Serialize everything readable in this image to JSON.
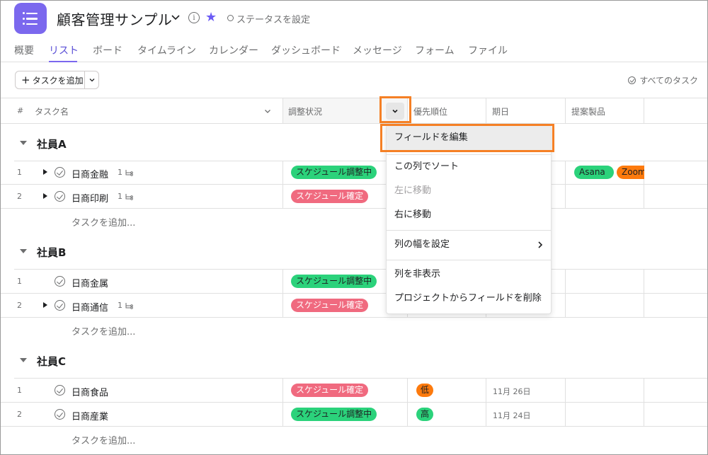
{
  "header": {
    "project_title": "顧客管理サンプル",
    "status_label": "ステータスを設定",
    "colors": {
      "brand": "#7b68ee",
      "star": "#6b5bf5"
    }
  },
  "tabs": [
    {
      "label": "概要"
    },
    {
      "label": "リスト",
      "active": true
    },
    {
      "label": "ボード"
    },
    {
      "label": "タイムライン"
    },
    {
      "label": "カレンダー"
    },
    {
      "label": "ダッシュボード"
    },
    {
      "label": "メッセージ"
    },
    {
      "label": "フォーム"
    },
    {
      "label": "ファイル"
    }
  ],
  "toolbar": {
    "add_task_label": "タスクを追加",
    "all_tasks_label": "すべてのタスク"
  },
  "columns": {
    "hash": "#",
    "task_name": "タスク名",
    "status": "調整状況",
    "priority": "優先順位",
    "due": "期日",
    "product": "提案製品"
  },
  "sections": [
    {
      "title": "社員A",
      "rows": [
        {
          "num": "1",
          "name": "日商金融",
          "subtasks": "1",
          "status": "スケジュール調整中",
          "status_color": "green",
          "products": [
            "Asana",
            "Zoom"
          ]
        },
        {
          "num": "2",
          "name": "日商印刷",
          "subtasks": "1",
          "status": "スケジュール確定",
          "status_color": "red"
        }
      ],
      "add_task": "タスクを追加..."
    },
    {
      "title": "社員B",
      "rows": [
        {
          "num": "1",
          "name": "日商金属",
          "status": "スケジュール調整中",
          "status_color": "green"
        },
        {
          "num": "2",
          "name": "日商通信",
          "subtasks": "1",
          "status": "スケジュール確定",
          "status_color": "red"
        }
      ],
      "add_task": "タスクを追加..."
    },
    {
      "title": "社員C",
      "rows": [
        {
          "num": "1",
          "name": "日商食品",
          "status": "スケジュール確定",
          "status_color": "red",
          "priority": "低",
          "due": "11月 26日"
        },
        {
          "num": "2",
          "name": "日商産業",
          "status": "スケジュール調整中",
          "status_color": "green",
          "priority": "高",
          "due": "11月 24日"
        }
      ],
      "add_task": "タスクを追加..."
    }
  ],
  "menu": {
    "items": [
      {
        "label": "フィールドを編集",
        "selected": true
      },
      {
        "label": "この列でソート"
      },
      {
        "label": "左に移動",
        "disabled": true
      },
      {
        "label": "右に移動"
      },
      {
        "label": "列の幅を設定",
        "submenu": true
      },
      {
        "label": "列を非表示"
      },
      {
        "label": "プロジェクトからフィールドを削除"
      }
    ]
  },
  "colors": {
    "status_green": "#2bd27b",
    "status_red": "#f06a7f",
    "priority_orange": "#fd7a0d",
    "highlight": "#f58025"
  }
}
